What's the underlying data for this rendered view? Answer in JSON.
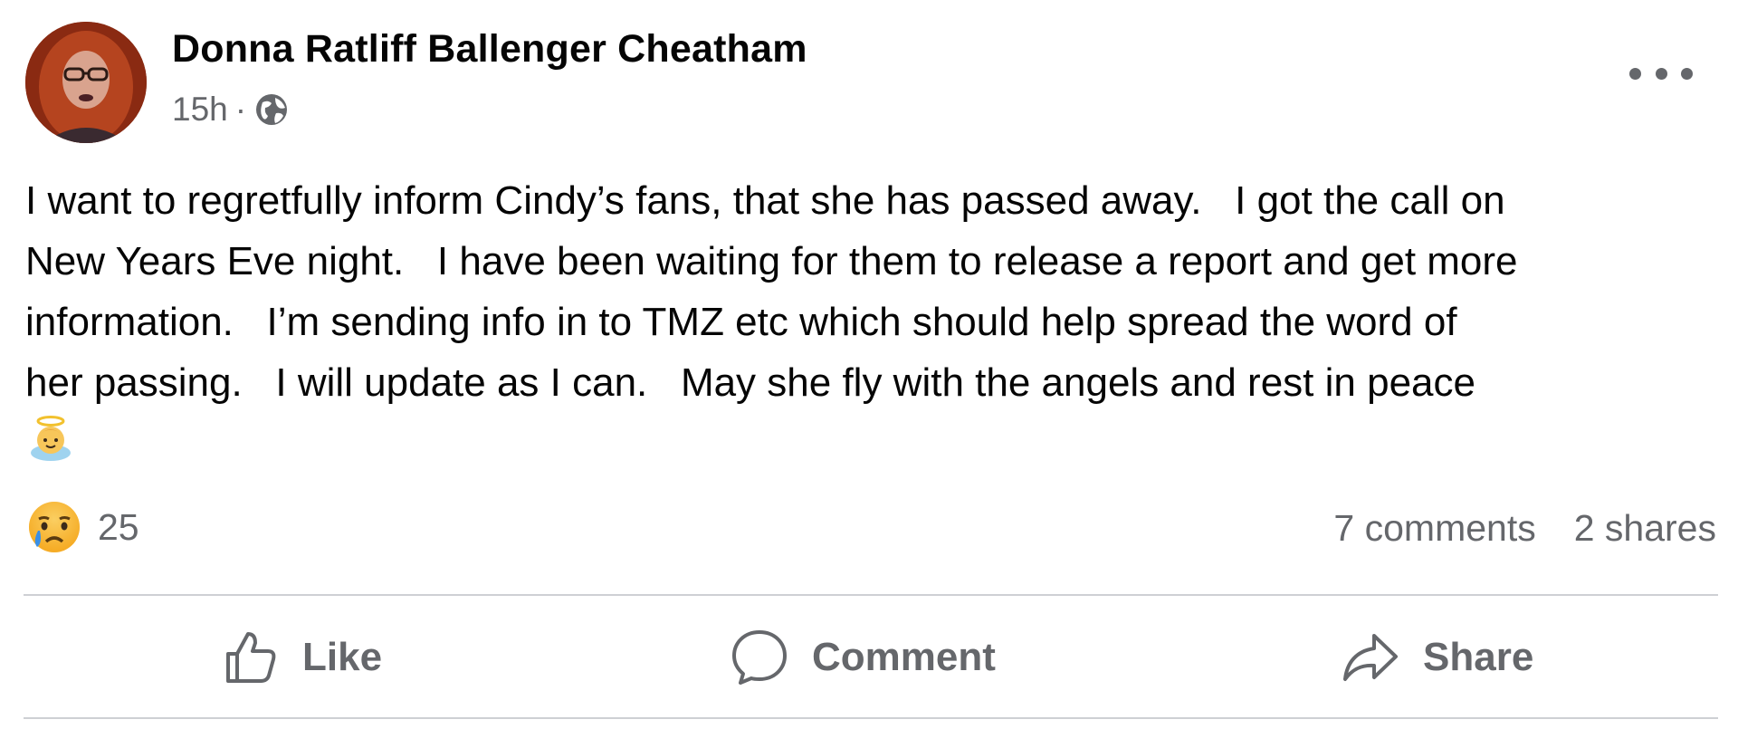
{
  "post": {
    "author": "Donna Ratliff Ballenger Cheatham",
    "time": "15h",
    "separator": "·",
    "privacy_icon": "globe-icon",
    "more_icon": "more-options-icon",
    "body": "I want to regretfully inform Cindy’s fans, that she has passed away.   I got the call on New Years Eve night.   I have been waiting for them to release a report and get more information.   I’m sending info in to TMZ etc which should help spread the word of her passing.   I will update as I can.   May she fly with the angels and rest in peace",
    "body_lines": [
      "I want to regretfully inform Cindy’s fans, that she has passed away.   I got the call on",
      "New Years Eve night.   I have been waiting for them to release a report and get more",
      "information.   I’m sending info in to TMZ etc which should help spread the word of",
      "her passing.   I will update as I can.   May she fly with the angels and rest in peace"
    ],
    "trailing_emoji": "angel-emoji"
  },
  "engagement": {
    "reaction_icon": "sad-cry-emoji",
    "reaction_count": "25",
    "comments": "7 comments",
    "shares": "2 shares"
  },
  "actions": {
    "like_label": "Like",
    "comment_label": "Comment",
    "share_label": "Share"
  },
  "colors": {
    "text_primary": "#050505",
    "text_secondary": "#65676b",
    "divider": "#ced0d4"
  }
}
